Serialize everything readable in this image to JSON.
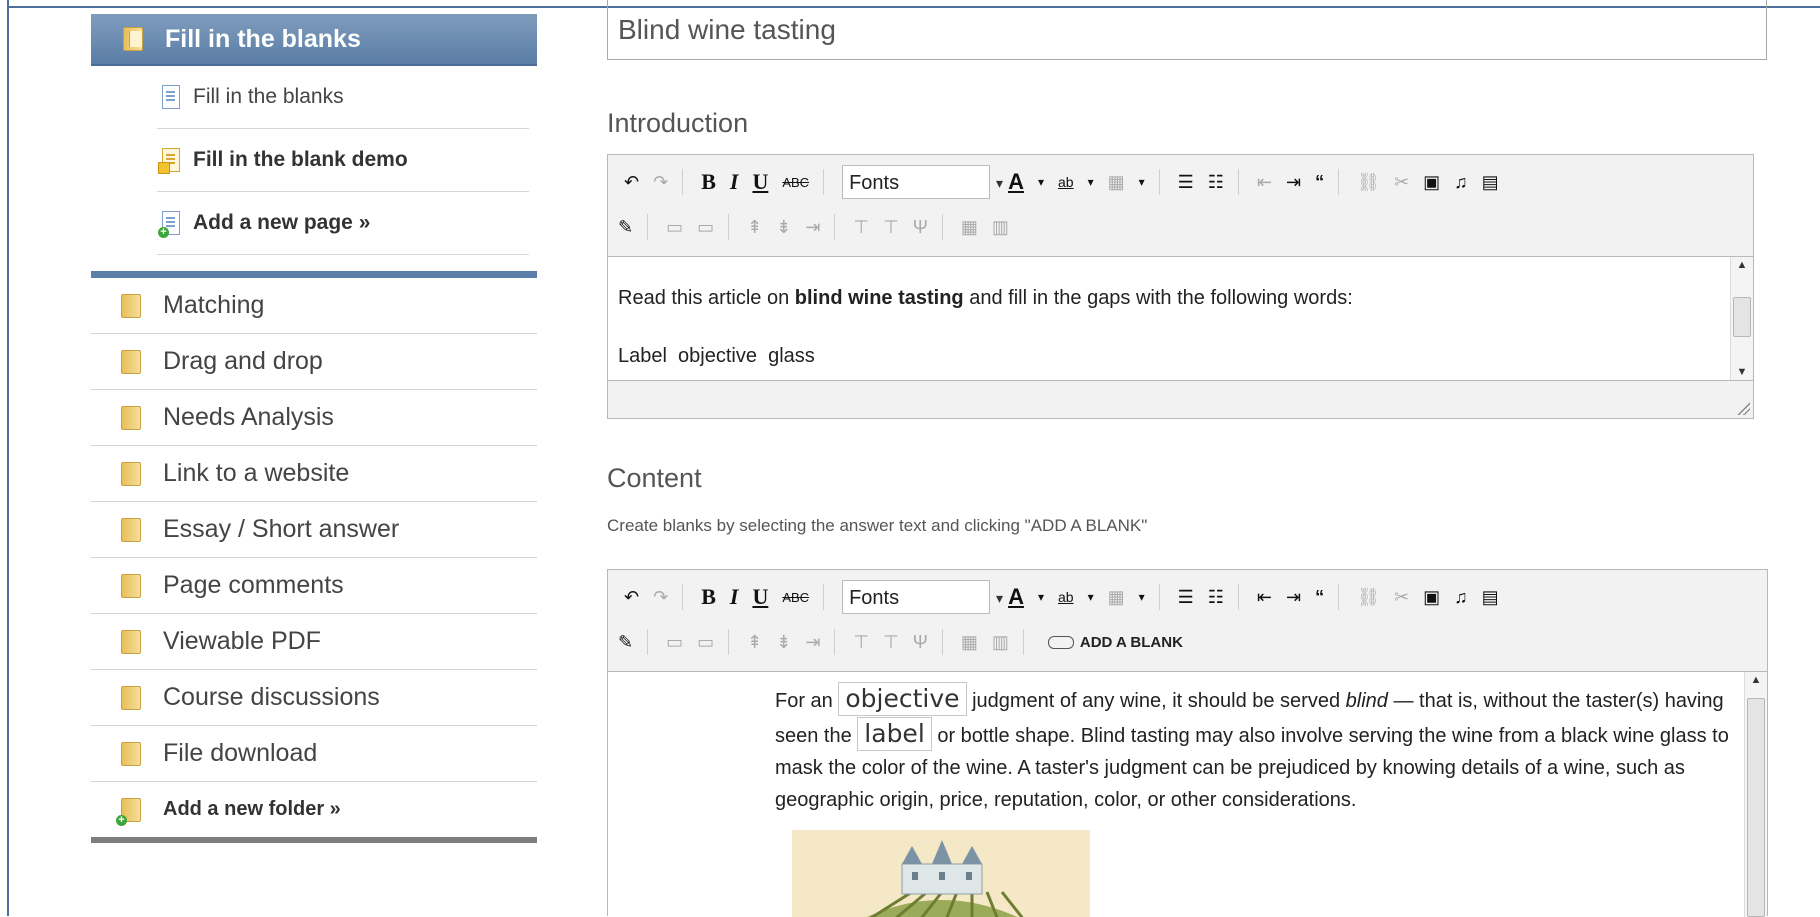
{
  "sidebar": {
    "active_folder": "Fill in the blanks",
    "pages": [
      {
        "label": "Fill in the blanks"
      },
      {
        "label": "Fill in the blank demo"
      },
      {
        "label": "Add a new page »"
      }
    ],
    "folders": [
      {
        "label": "Matching"
      },
      {
        "label": "Drag and drop"
      },
      {
        "label": "Needs Analysis"
      },
      {
        "label": "Link to a website"
      },
      {
        "label": "Essay / Short answer"
      },
      {
        "label": "Page comments"
      },
      {
        "label": "Viewable PDF"
      },
      {
        "label": "Course discussions"
      },
      {
        "label": "File download"
      }
    ],
    "add_folder": "Add a new folder »"
  },
  "main": {
    "title_value": "Blind wine tasting",
    "introduction_label": "Introduction",
    "content_label": "Content",
    "content_hint": "Create blanks by selecting the answer text and clicking \"ADD A BLANK\"",
    "toolbar": {
      "fonts": "Fonts",
      "add_blank": "ADD A BLANK"
    },
    "intro": {
      "line1_pre": "Read this article on ",
      "line1_bold": "blind wine tasting",
      "line1_post": " and fill in the gaps with the following words:",
      "line2": "Label  objective  glass"
    },
    "content": {
      "p1": "For an ",
      "blank1": "objective",
      "p2": " judgment of any wine, it should be served ",
      "p2_italic": "blind",
      "p3": " — that is, without the taster(s) having seen the ",
      "blank2": "label",
      "p4": " or bottle shape. Blind tasting may also involve serving the wine from a black wine glass to mask the color of the wine. A taster's judgment can be prejudiced by knowing details of a wine, such as geographic origin, price, reputation, color, or other considerations."
    }
  }
}
